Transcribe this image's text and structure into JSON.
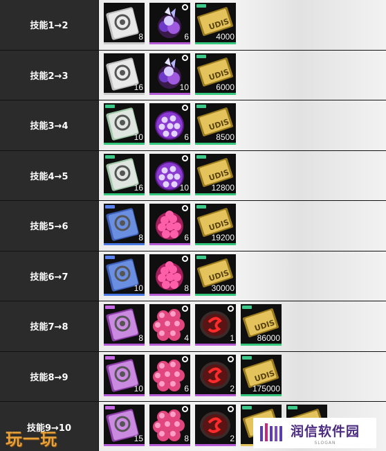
{
  "rows": [
    {
      "label": "技能1→2",
      "items": [
        {
          "icon": "silver-badge-icon",
          "rarity": "r-white",
          "qty": "8"
        },
        {
          "icon": "crystal-cluster-icon",
          "rarity": "r-purple",
          "qty": "6"
        },
        {
          "icon": "gold-ticket-icon",
          "rarity": "r-green",
          "qty": "4000"
        }
      ]
    },
    {
      "label": "技能2→3",
      "items": [
        {
          "icon": "silver-badge-icon",
          "rarity": "r-white",
          "qty": "16"
        },
        {
          "icon": "crystal-cluster-icon",
          "rarity": "r-purple",
          "qty": "10"
        },
        {
          "icon": "gold-ticket-icon",
          "rarity": "r-green",
          "qty": "6000"
        }
      ]
    },
    {
      "label": "技能3→4",
      "items": [
        {
          "icon": "green-badge-icon",
          "rarity": "r-green",
          "qty": "10"
        },
        {
          "icon": "violet-orb-icon",
          "rarity": "r-green",
          "qty": "6"
        },
        {
          "icon": "gold-ticket-icon",
          "rarity": "r-green",
          "qty": "8500"
        }
      ]
    },
    {
      "label": "技能4→5",
      "items": [
        {
          "icon": "green-badge-icon",
          "rarity": "r-green",
          "qty": "16"
        },
        {
          "icon": "violet-orb-icon",
          "rarity": "r-green",
          "qty": "10"
        },
        {
          "icon": "gold-ticket-icon",
          "rarity": "r-green",
          "qty": "12800"
        }
      ]
    },
    {
      "label": "技能5→6",
      "items": [
        {
          "icon": "blue-badge-icon",
          "rarity": "r-blue",
          "qty": "8"
        },
        {
          "icon": "pink-orb-icon",
          "rarity": "r-purple",
          "qty": "6"
        },
        {
          "icon": "gold-ticket-icon",
          "rarity": "r-green",
          "qty": "19200"
        }
      ]
    },
    {
      "label": "技能6→7",
      "items": [
        {
          "icon": "blue-badge-icon",
          "rarity": "r-blue",
          "qty": "10"
        },
        {
          "icon": "pink-orb-icon",
          "rarity": "r-purple",
          "qty": "8"
        },
        {
          "icon": "gold-ticket-icon",
          "rarity": "r-green",
          "qty": "30000"
        }
      ]
    },
    {
      "label": "技能7→8",
      "items": [
        {
          "icon": "purple-badge-icon",
          "rarity": "r-purple",
          "qty": "8"
        },
        {
          "icon": "pink-cluster-icon",
          "rarity": "r-purple",
          "qty": "4"
        },
        {
          "icon": "red-core-icon",
          "rarity": "r-purple",
          "qty": "1"
        },
        {
          "icon": "gold-ticket-icon",
          "rarity": "r-green",
          "qty": "86000"
        }
      ]
    },
    {
      "label": "技能8→9",
      "items": [
        {
          "icon": "purple-badge-icon",
          "rarity": "r-purple",
          "qty": "10"
        },
        {
          "icon": "pink-cluster-icon",
          "rarity": "r-purple",
          "qty": "6"
        },
        {
          "icon": "red-core-icon",
          "rarity": "r-purple",
          "qty": "2"
        },
        {
          "icon": "gold-ticket-icon",
          "rarity": "r-green",
          "qty": "175000"
        }
      ]
    },
    {
      "label": "技能9→10",
      "items": [
        {
          "icon": "purple-badge-icon",
          "rarity": "r-purple",
          "qty": "15"
        },
        {
          "icon": "pink-cluster-icon",
          "rarity": "r-purple",
          "qty": "8"
        },
        {
          "icon": "red-core-icon",
          "rarity": "r-purple",
          "qty": "2"
        },
        {
          "icon": "gold-ticket-icon",
          "rarity": "r-gold",
          "qty": ""
        },
        {
          "icon": "gold-ticket-icon",
          "rarity": "r-gold",
          "qty": ""
        }
      ]
    }
  ],
  "watermark_left": "玩一玩",
  "brand": {
    "name": "润信软件园",
    "slogan": "SLOGAN"
  },
  "colors": {
    "label_bg": "#2b2b2b",
    "green": "#36c77e",
    "purple": "#b65bd6",
    "blue": "#4a79e6",
    "gold": "#e3c35c"
  }
}
